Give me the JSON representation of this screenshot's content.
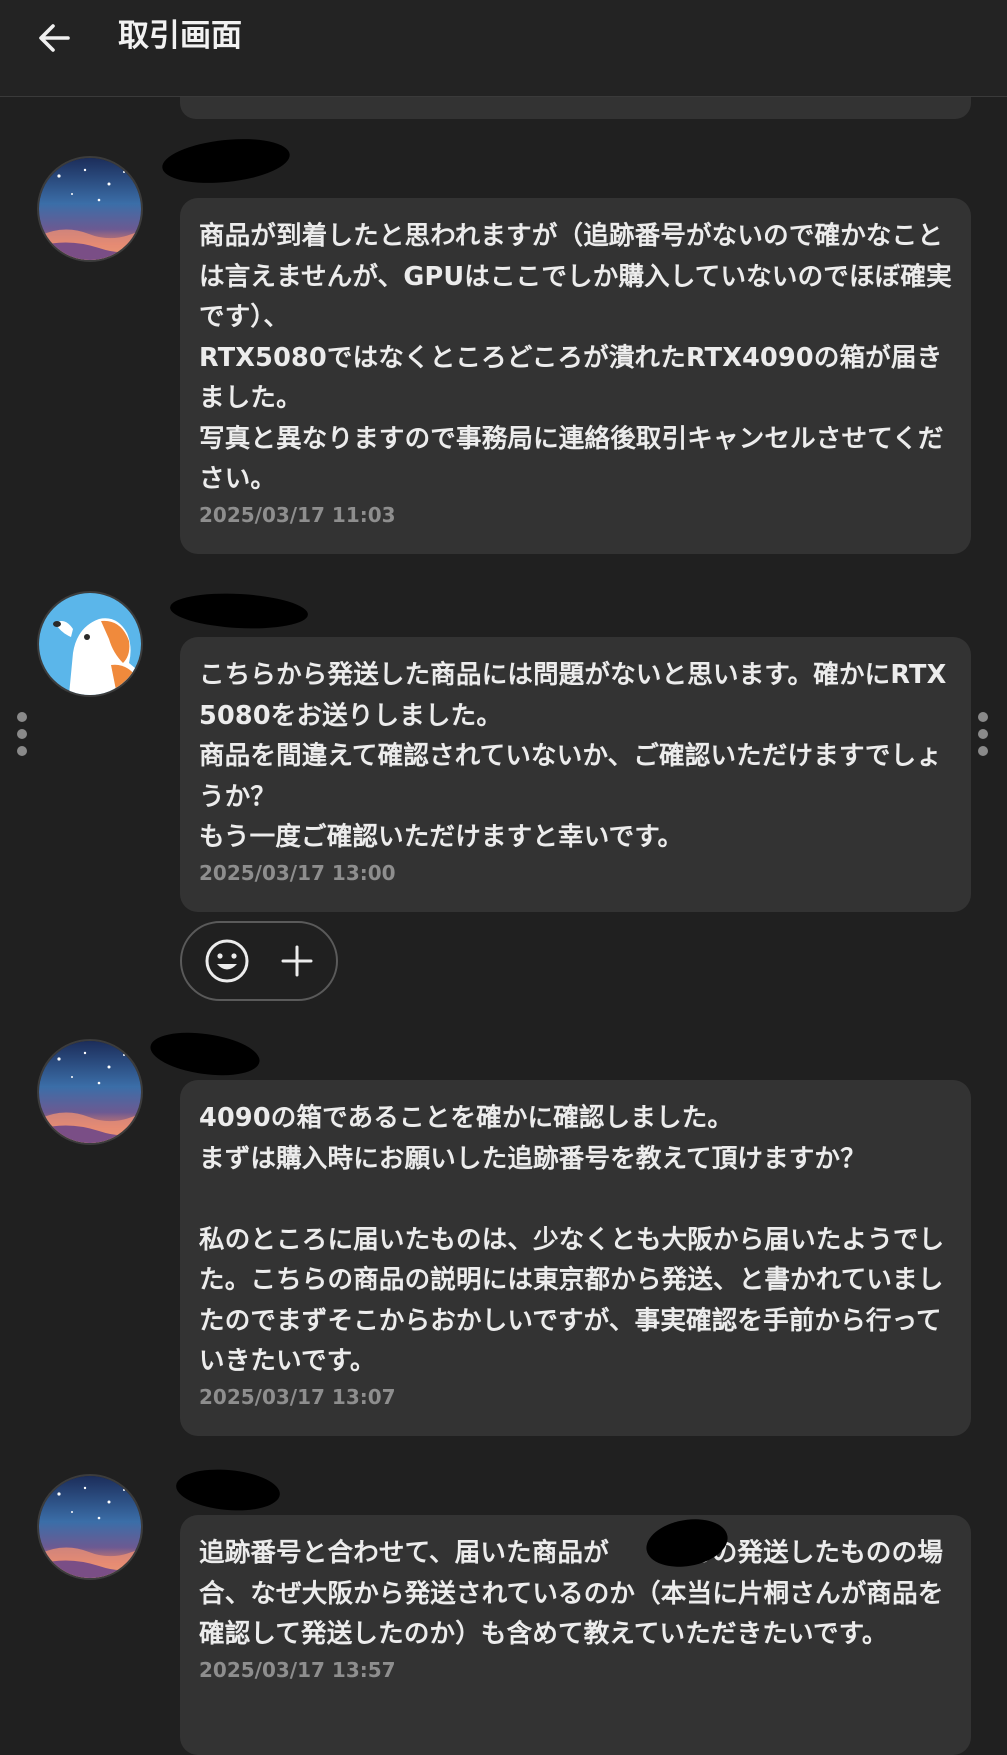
{
  "header": {
    "title": "取引画面",
    "back_icon": "arrow-left-icon"
  },
  "messages": [
    {
      "avatar": "starry-sky-avatar",
      "text": "商品が到着したと思われますが（追跡番号がないので確かなことは言えませんが、GPUはここでしか購入していないのでほぼ確実です）、\nRTX5080ではなくところどころが潰れたRTX4090の箱が届きました。\n写真と異なりますので事務局に連絡後取引キャンセルさせてください。",
      "time": "2025/03/17 11:03"
    },
    {
      "avatar": "dog-avatar",
      "text": "こちらから発送した商品には問題がないと思います。確かにRTX 5080をお送りしました。\n商品を間違えて確認されていないか、ご確認いただけますでしょうか？\nもう一度ご確認いただけますと幸いです。",
      "time": "2025/03/17 13:00"
    },
    {
      "avatar": "starry-sky-avatar",
      "text": "4090の箱であることを確かに確認しました。\nまずは購入時にお願いした追跡番号を教えて頂けますか？\n\n私のところに届いたものは、少なくとも大阪から届いたようでした。こちらの商品の説明には東京都から発送、と書かれていましたのでまずそこからおかしいですが、事実確認を手前から行っていきたいです。",
      "time": "2025/03/17 13:07"
    },
    {
      "avatar": "starry-sky-avatar",
      "text": "追跡番号と合わせて、届いた商品が　　さんの発送したものの場合、なぜ大阪から発送されているのか（本当に片桐さんが商品を確認して発送したのか）も含めて教えていただきたいです。",
      "time": "2025/03/17 13:57"
    }
  ],
  "reactions": {
    "emoji_icon": "smiley-icon",
    "add_icon": "plus-icon"
  },
  "colors": {
    "background": "#202020",
    "bubble": "#333333",
    "text": "#ececec",
    "timestamp": "#8e8e8e"
  }
}
